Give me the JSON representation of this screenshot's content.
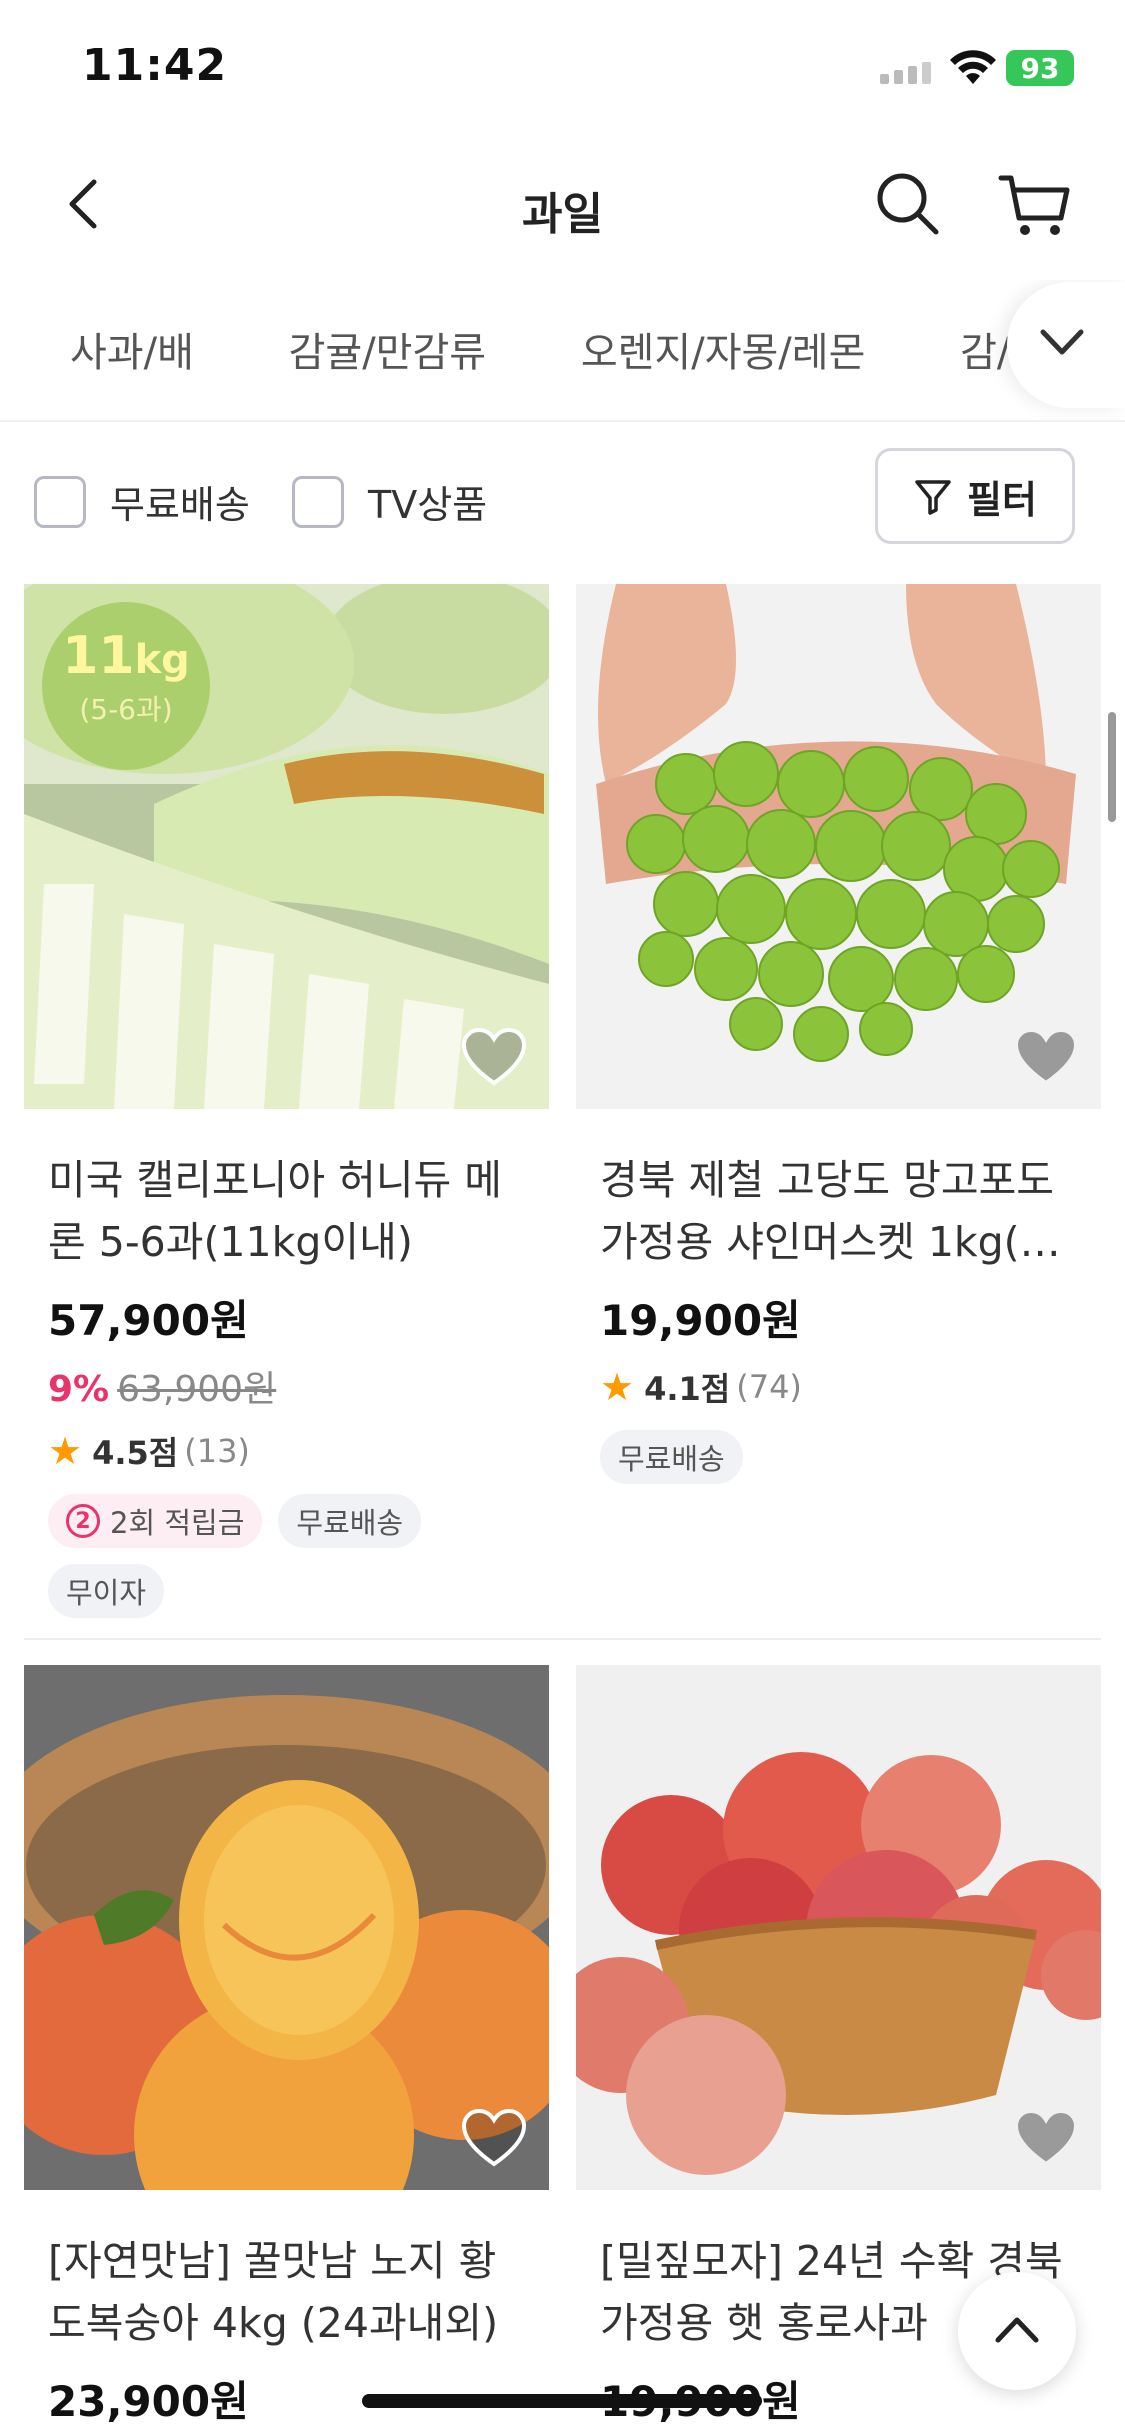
{
  "status_bar": {
    "time": "11:42",
    "battery": "93"
  },
  "header": {
    "title": "과일"
  },
  "categories": [
    "사과/배",
    "감귤/만감류",
    "오렌지/자몽/레몬",
    "감/곶감"
  ],
  "filters": {
    "free_shipping": "무료배송",
    "tv_product": "TV상품",
    "filter_button": "필터"
  },
  "products": [
    {
      "name": "미국 캘리포니아 허니듀 메론 5-6과(11kg이내)",
      "price": "57,900원",
      "discount_pct": "9%",
      "original_price": "63,900원",
      "rating": "4.5점",
      "review_count": "(13)",
      "badge_weight": "11",
      "badge_unit": "kg",
      "badge_count": "(5-6과)",
      "tags": {
        "points_num": "2",
        "points": "2회 적립금",
        "shipping": "무료배송",
        "installment": "무이자"
      }
    },
    {
      "name": "경북 제철 고당도 망고포도 가정용 샤인머스켓 1kg(…",
      "price": "19,900원",
      "rating": "4.1점",
      "review_count": "(74)",
      "tags": {
        "shipping": "무료배송"
      }
    },
    {
      "name": "[자연맛남] 꿀맛남 노지 황도복숭아 4kg (24과내외)",
      "price": "23,900원"
    },
    {
      "name": "[밀짚모자] 24년 수확 경북 가정용 햇 홍로사과",
      "price": "19,900원"
    }
  ],
  "colors": {
    "accent": "#e8336b",
    "star": "#ff9b00",
    "battery": "#36c759"
  }
}
